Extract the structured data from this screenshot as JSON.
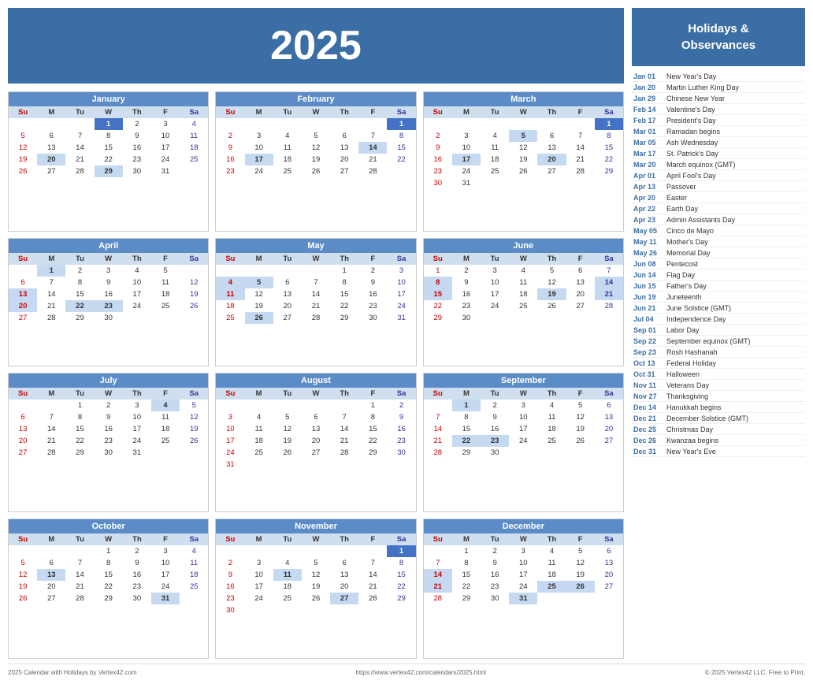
{
  "year": "2025",
  "header_title": "2025",
  "sidebar": {
    "title": "Holidays &\nObservances",
    "holidays": [
      {
        "date": "Jan 01",
        "name": "New Year's Day"
      },
      {
        "date": "Jan 20",
        "name": "Martin Luther King Day"
      },
      {
        "date": "Jan 29",
        "name": "Chinese New Year"
      },
      {
        "date": "Feb 14",
        "name": "Valentine's Day"
      },
      {
        "date": "Feb 17",
        "name": "President's Day"
      },
      {
        "date": "Mar 01",
        "name": "Ramadan begins"
      },
      {
        "date": "Mar 05",
        "name": "Ash Wednesday"
      },
      {
        "date": "Mar 17",
        "name": "St. Patrick's Day"
      },
      {
        "date": "Mar 20",
        "name": "March equinox (GMT)"
      },
      {
        "date": "Apr 01",
        "name": "April Fool's Day"
      },
      {
        "date": "Apr 13",
        "name": "Passover"
      },
      {
        "date": "Apr 20",
        "name": "Easter"
      },
      {
        "date": "Apr 22",
        "name": "Earth Day"
      },
      {
        "date": "Apr 23",
        "name": "Admin Assistants Day"
      },
      {
        "date": "May 05",
        "name": "Cinco de Mayo"
      },
      {
        "date": "May 11",
        "name": "Mother's Day"
      },
      {
        "date": "May 26",
        "name": "Memorial Day"
      },
      {
        "date": "Jun 08",
        "name": "Pentecost"
      },
      {
        "date": "Jun 14",
        "name": "Flag Day"
      },
      {
        "date": "Jun 15",
        "name": "Father's Day"
      },
      {
        "date": "Jun 19",
        "name": "Juneteenth"
      },
      {
        "date": "Jun 21",
        "name": "June Solstice (GMT)"
      },
      {
        "date": "Jul 04",
        "name": "Independence Day"
      },
      {
        "date": "Sep 01",
        "name": "Labor Day"
      },
      {
        "date": "Sep 22",
        "name": "September equinox (GMT)"
      },
      {
        "date": "Sep 23",
        "name": "Rosh Hashanah"
      },
      {
        "date": "Oct 13",
        "name": "Federal Holiday"
      },
      {
        "date": "Oct 31",
        "name": "Halloween"
      },
      {
        "date": "Nov 11",
        "name": "Veterans Day"
      },
      {
        "date": "Nov 27",
        "name": "Thanksgiving"
      },
      {
        "date": "Dec 14",
        "name": "Hanukkah begins"
      },
      {
        "date": "Dec 21",
        "name": "December Solstice (GMT)"
      },
      {
        "date": "Dec 25",
        "name": "Christmas Day"
      },
      {
        "date": "Dec 26",
        "name": "Kwanzaa begins"
      },
      {
        "date": "Dec 31",
        "name": "New Year's Eve"
      }
    ]
  },
  "footer": {
    "left": "2025 Calendar with Holidays by Vertex42.com",
    "center": "https://www.vertex42.com/calendars/2025.html",
    "right": "© 2025 Vertex42 LLC. Free to Print."
  },
  "months": [
    {
      "name": "January",
      "weeks": [
        [
          "",
          "",
          "",
          "1",
          "2",
          "3",
          "4"
        ],
        [
          "5",
          "6",
          "7",
          "8",
          "9",
          "10",
          "11"
        ],
        [
          "12",
          "13",
          "14",
          "15",
          "16",
          "17",
          "18"
        ],
        [
          "19",
          "20",
          "21",
          "22",
          "23",
          "24",
          "25"
        ],
        [
          "26",
          "27",
          "28",
          "29",
          "30",
          "31",
          ""
        ]
      ],
      "highlights": {
        "1": "dark",
        "20": "blue",
        "29": "blue"
      }
    },
    {
      "name": "February",
      "weeks": [
        [
          "",
          "",
          "",
          "",
          "",
          "",
          "1"
        ],
        [
          "2",
          "3",
          "4",
          "5",
          "6",
          "7",
          "8"
        ],
        [
          "9",
          "10",
          "11",
          "12",
          "13",
          "14",
          "15"
        ],
        [
          "16",
          "17",
          "18",
          "19",
          "20",
          "21",
          "22"
        ],
        [
          "23",
          "24",
          "25",
          "26",
          "27",
          "28",
          ""
        ]
      ],
      "highlights": {
        "1": "sat-dark",
        "14": "blue",
        "17": "blue"
      }
    },
    {
      "name": "March",
      "weeks": [
        [
          "",
          "",
          "",
          "",
          "",
          "",
          "1"
        ],
        [
          "2",
          "3",
          "4",
          "5",
          "6",
          "7",
          "8"
        ],
        [
          "9",
          "10",
          "11",
          "12",
          "13",
          "14",
          "15"
        ],
        [
          "16",
          "17",
          "18",
          "19",
          "20",
          "21",
          "22"
        ],
        [
          "23",
          "24",
          "25",
          "26",
          "27",
          "28",
          "29"
        ],
        [
          "30",
          "31",
          "",
          "",
          "",
          "",
          ""
        ]
      ],
      "highlights": {
        "1": "sat-dark",
        "5": "blue",
        "17": "blue",
        "20": "blue"
      }
    },
    {
      "name": "April",
      "weeks": [
        [
          "",
          "1",
          "2",
          "3",
          "4",
          "5",
          ""
        ],
        [
          "6",
          "7",
          "8",
          "9",
          "10",
          "11",
          "12"
        ],
        [
          "13",
          "14",
          "15",
          "16",
          "17",
          "18",
          "19"
        ],
        [
          "20",
          "21",
          "22",
          "23",
          "24",
          "25",
          "26"
        ],
        [
          "27",
          "28",
          "29",
          "30",
          "",
          "",
          ""
        ]
      ],
      "highlights": {
        "1": "blue",
        "13": "blue",
        "20": "blue",
        "22": "blue",
        "23": "blue"
      }
    },
    {
      "name": "May",
      "weeks": [
        [
          "",
          "",
          "",
          "",
          "1",
          "2",
          "3"
        ],
        [
          "4",
          "5",
          "6",
          "7",
          "8",
          "9",
          "10"
        ],
        [
          "11",
          "12",
          "13",
          "14",
          "15",
          "16",
          "17"
        ],
        [
          "18",
          "19",
          "20",
          "21",
          "22",
          "23",
          "24"
        ],
        [
          "25",
          "26",
          "27",
          "28",
          "29",
          "30",
          "31"
        ]
      ],
      "highlights": {
        "4": "blue",
        "5": "blue",
        "11": "blue",
        "26": "blue"
      }
    },
    {
      "name": "June",
      "weeks": [
        [
          "1",
          "2",
          "3",
          "4",
          "5",
          "6",
          "7"
        ],
        [
          "8",
          "9",
          "10",
          "11",
          "12",
          "13",
          "14"
        ],
        [
          "15",
          "16",
          "17",
          "18",
          "19",
          "20",
          "21"
        ],
        [
          "22",
          "23",
          "24",
          "25",
          "26",
          "27",
          "28"
        ],
        [
          "29",
          "30",
          "",
          "",
          "",
          "",
          ""
        ]
      ],
      "highlights": {
        "8": "blue",
        "14": "blue",
        "15": "blue",
        "19": "blue",
        "21": "blue"
      }
    },
    {
      "name": "July",
      "weeks": [
        [
          "",
          "",
          "1",
          "2",
          "3",
          "4",
          "5"
        ],
        [
          "6",
          "7",
          "8",
          "9",
          "10",
          "11",
          "12"
        ],
        [
          "13",
          "14",
          "15",
          "16",
          "17",
          "18",
          "19"
        ],
        [
          "20",
          "21",
          "22",
          "23",
          "24",
          "25",
          "26"
        ],
        [
          "27",
          "28",
          "29",
          "30",
          "31",
          "",
          ""
        ]
      ],
      "highlights": {
        "4": "blue"
      }
    },
    {
      "name": "August",
      "weeks": [
        [
          "",
          "",
          "",
          "",
          "",
          "1",
          "2"
        ],
        [
          "3",
          "4",
          "5",
          "6",
          "7",
          "8",
          "9"
        ],
        [
          "10",
          "11",
          "12",
          "13",
          "14",
          "15",
          "16"
        ],
        [
          "17",
          "18",
          "19",
          "20",
          "21",
          "22",
          "23"
        ],
        [
          "24",
          "25",
          "26",
          "27",
          "28",
          "29",
          "30"
        ],
        [
          "31",
          "",
          "",
          "",
          "",
          "",
          ""
        ]
      ],
      "highlights": {}
    },
    {
      "name": "September",
      "weeks": [
        [
          "",
          "1",
          "2",
          "3",
          "4",
          "5",
          "6"
        ],
        [
          "7",
          "8",
          "9",
          "10",
          "11",
          "12",
          "13"
        ],
        [
          "14",
          "15",
          "16",
          "17",
          "18",
          "19",
          "20"
        ],
        [
          "21",
          "22",
          "23",
          "24",
          "25",
          "26",
          "27"
        ],
        [
          "28",
          "29",
          "30",
          "",
          "",
          "",
          ""
        ]
      ],
      "highlights": {
        "1": "blue",
        "22": "blue",
        "23": "blue"
      }
    },
    {
      "name": "October",
      "weeks": [
        [
          "",
          "",
          "",
          "1",
          "2",
          "3",
          "4"
        ],
        [
          "5",
          "6",
          "7",
          "8",
          "9",
          "10",
          "11"
        ],
        [
          "12",
          "13",
          "14",
          "15",
          "16",
          "17",
          "18"
        ],
        [
          "19",
          "20",
          "21",
          "22",
          "23",
          "24",
          "25"
        ],
        [
          "26",
          "27",
          "28",
          "29",
          "30",
          "31",
          ""
        ]
      ],
      "highlights": {
        "13": "blue",
        "31": "blue"
      }
    },
    {
      "name": "November",
      "weeks": [
        [
          "",
          "",
          "",
          "",
          "",
          "",
          "1"
        ],
        [
          "2",
          "3",
          "4",
          "5",
          "6",
          "7",
          "8"
        ],
        [
          "9",
          "10",
          "11",
          "12",
          "13",
          "14",
          "15"
        ],
        [
          "16",
          "17",
          "18",
          "19",
          "20",
          "21",
          "22"
        ],
        [
          "23",
          "24",
          "25",
          "26",
          "27",
          "28",
          "29"
        ],
        [
          "30",
          "",
          "",
          "",
          "",
          "",
          ""
        ]
      ],
      "highlights": {
        "1": "sat-dark",
        "11": "blue",
        "27": "blue"
      }
    },
    {
      "name": "December",
      "weeks": [
        [
          "",
          "1",
          "2",
          "3",
          "4",
          "5",
          "6"
        ],
        [
          "7",
          "8",
          "9",
          "10",
          "11",
          "12",
          "13"
        ],
        [
          "14",
          "15",
          "16",
          "17",
          "18",
          "19",
          "20"
        ],
        [
          "21",
          "22",
          "23",
          "24",
          "25",
          "26",
          "27"
        ],
        [
          "28",
          "29",
          "30",
          "31",
          "",
          "",
          ""
        ]
      ],
      "highlights": {
        "14": "blue",
        "21": "blue",
        "25": "blue",
        "26": "blue",
        "31": "blue"
      }
    }
  ]
}
